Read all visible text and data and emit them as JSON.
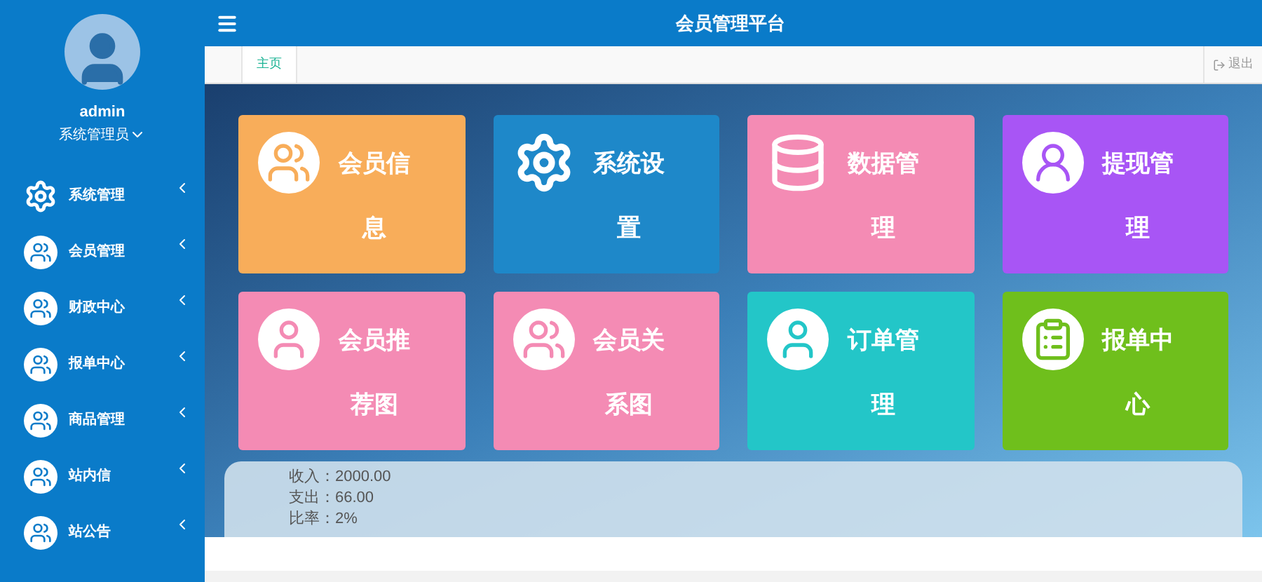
{
  "header": {
    "title": "会员管理平台"
  },
  "user": {
    "name": "admin",
    "role": "系统管理员"
  },
  "sidebar": {
    "items": [
      {
        "label": "系统管理",
        "kind": "gear"
      },
      {
        "label": "会员管理",
        "kind": "users"
      },
      {
        "label": "财政中心",
        "kind": "users"
      },
      {
        "label": "报单中心",
        "kind": "users"
      },
      {
        "label": "商品管理",
        "kind": "users"
      },
      {
        "label": "站内信",
        "kind": "users"
      },
      {
        "label": "站公告",
        "kind": "users"
      }
    ]
  },
  "tabs": [
    {
      "label": "主页",
      "selected": true
    }
  ],
  "logout": "退出",
  "tiles": [
    {
      "title": "会员信息",
      "kind": "users",
      "color": "#f8ad5a"
    },
    {
      "title": "系统设置",
      "kind": "gear",
      "color": "#1e88c9"
    },
    {
      "title": "数据管理",
      "kind": "database",
      "color": "#f48bb4"
    },
    {
      "title": "提现管理",
      "kind": "user-tie",
      "color": "#a855f5"
    },
    {
      "title": "会员推荐图",
      "kind": "user",
      "color": "#f48bb4"
    },
    {
      "title": "会员关系图",
      "kind": "users",
      "color": "#f48bb4"
    },
    {
      "title": "订单管理",
      "kind": "user",
      "color": "#23c6c8"
    },
    {
      "title": "报单中心",
      "kind": "doc",
      "color": "#6fbf1c"
    }
  ],
  "stats": [
    "收入：2000.00",
    "支出：66.00",
    "比率：2%"
  ]
}
